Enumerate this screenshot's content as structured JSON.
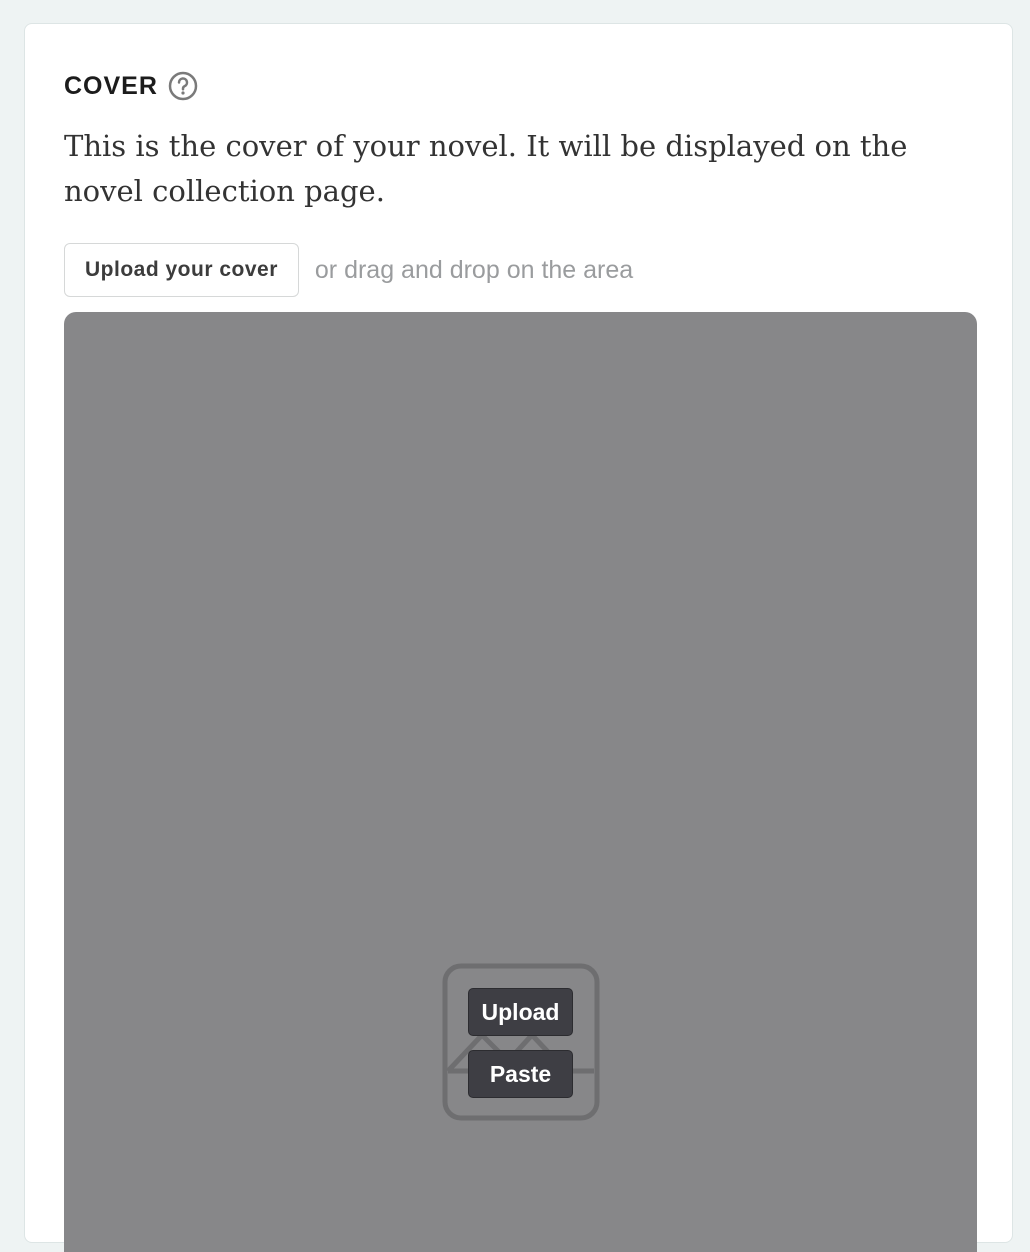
{
  "section": {
    "title": "COVER",
    "help_icon": "question-circle-icon",
    "description": "This is the cover of your novel. It will be displayed on the novel collection page."
  },
  "upload": {
    "button_label": "Upload your cover",
    "hint": "or drag and drop on the area"
  },
  "dropzone": {
    "placeholder_icon": "image-placeholder-icon",
    "upload_label": "Upload",
    "paste_label": "Paste"
  },
  "colors": {
    "page_bg": "#eef3f3",
    "dropzone_bg": "#878789",
    "overlay_button_bg": "#3e3e44"
  }
}
